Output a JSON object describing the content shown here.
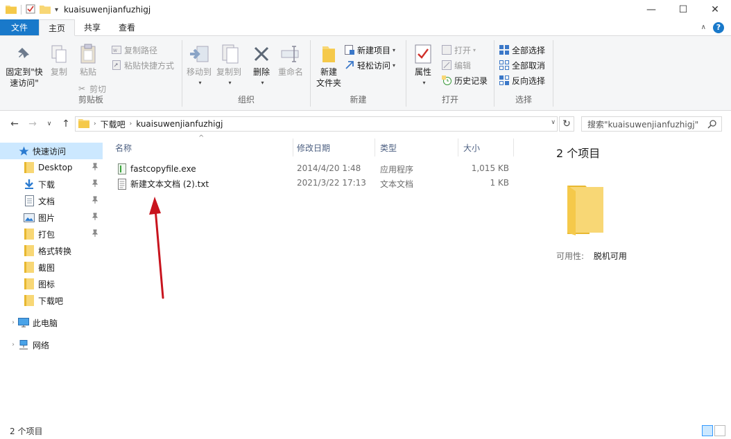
{
  "window": {
    "title": "kuaisuwenjianfuzhigj",
    "controls": [
      "—",
      "☐",
      "✕"
    ]
  },
  "ribbon_tabs": {
    "file": "文件",
    "home": "主页",
    "share": "共享",
    "view": "查看"
  },
  "ribbon": {
    "clipboard": {
      "label": "剪贴板",
      "pin_quick": "固定到\"快\n速访问\"",
      "copy": "复制",
      "paste": "粘贴",
      "copy_path": "复制路径",
      "paste_shortcut": "粘贴快捷方式",
      "cut": "剪切"
    },
    "organize": {
      "label": "组织",
      "move_to": "移动到",
      "copy_to": "复制到",
      "delete": "删除",
      "rename": "重命名"
    },
    "new": {
      "label": "新建",
      "new_folder": "新建\n文件夹",
      "new_item": "新建项目",
      "easy_access": "轻松访问"
    },
    "open": {
      "label": "打开",
      "properties": "属性",
      "open": "打开",
      "edit": "编辑",
      "history": "历史记录"
    },
    "select": {
      "label": "选择",
      "select_all": "全部选择",
      "select_none": "全部取消",
      "invert": "反向选择"
    }
  },
  "address": {
    "crumbs": [
      "下载吧",
      "kuaisuwenjianfuzhigj"
    ],
    "search_placeholder": "搜索\"kuaisuwenjianfuzhigj\""
  },
  "nav": {
    "quick_access": "快速访问",
    "items": [
      {
        "label": "Desktop",
        "pinned": true
      },
      {
        "label": "下载",
        "pinned": true
      },
      {
        "label": "文档",
        "pinned": true
      },
      {
        "label": "图片",
        "pinned": true
      },
      {
        "label": "打包",
        "pinned": true
      },
      {
        "label": "格式转换",
        "pinned": false
      },
      {
        "label": "截图",
        "pinned": false
      },
      {
        "label": "图标",
        "pinned": false
      },
      {
        "label": "下载吧",
        "pinned": false
      }
    ],
    "this_pc": "此电脑",
    "network": "网络"
  },
  "columns": {
    "name": "名称",
    "date": "修改日期",
    "type": "类型",
    "size": "大小"
  },
  "files": [
    {
      "name": "fastcopyfile.exe",
      "date": "2014/4/20 1:48",
      "type": "应用程序",
      "size": "1,015 KB",
      "icon": "exe-icon"
    },
    {
      "name": "新建文本文档 (2).txt",
      "date": "2021/3/22 17:13",
      "type": "文本文档",
      "size": "1 KB",
      "icon": "txt-icon"
    }
  ],
  "details": {
    "count": "2 个项目",
    "availability_key": "可用性:",
    "availability_value": "脱机可用"
  },
  "status": {
    "count": "2 个项目"
  },
  "colors": {
    "accent": "#1979ca",
    "selection": "#cce8ff",
    "folder": "#f8d775",
    "annotation": "#c8141e"
  }
}
